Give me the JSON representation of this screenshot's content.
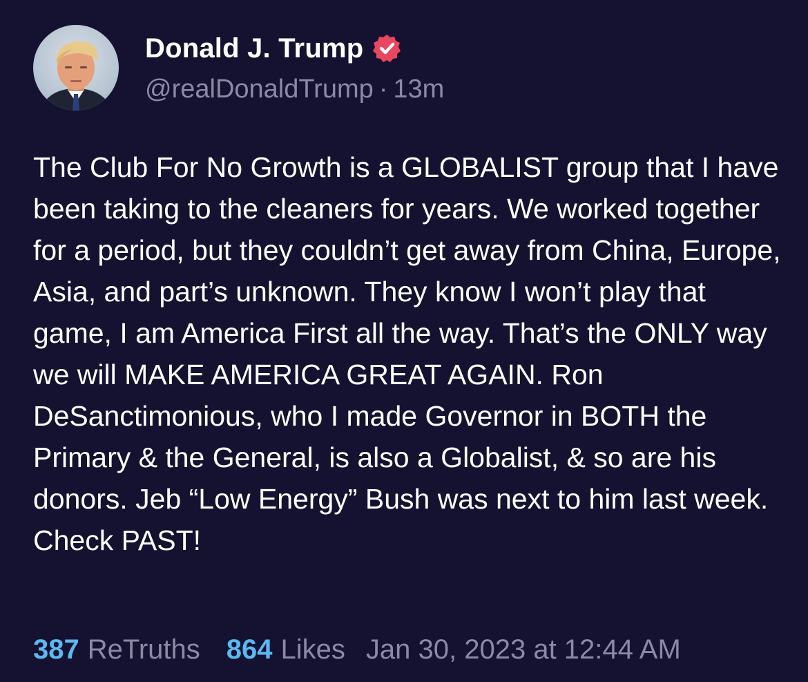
{
  "post": {
    "author": {
      "display_name": "Donald J. Trump",
      "handle": "@realDonaldTrump",
      "verified_icon": "verified-badge-icon",
      "verified_color": "#e8475f"
    },
    "relative_time": "13m",
    "separator": "·",
    "text": "The Club For No Growth is a GLOBALIST group that I have been taking to the cleaners for years. We worked together for a period, but they couldn’t get away from China, Europe, Asia, and part’s unknown. They know I won’t play that game, I am America First all the way. That’s the ONLY way we will MAKE AMERICA GREAT AGAIN. Ron DeSanctimonious, who I made Governor in BOTH the Primary & the General, is also a Globalist, & so are his donors. Jeb “Low Energy” Bush was next to him last week. Check PAST!",
    "stats": {
      "retruths_count": "387",
      "retruths_label": "ReTruths",
      "likes_count": "864",
      "likes_label": "Likes"
    },
    "timestamp": "Jan 30, 2023 at 12:44 AM"
  },
  "colors": {
    "background": "#141230",
    "accent": "#5cb8f0",
    "muted": "#8b8aa6"
  }
}
